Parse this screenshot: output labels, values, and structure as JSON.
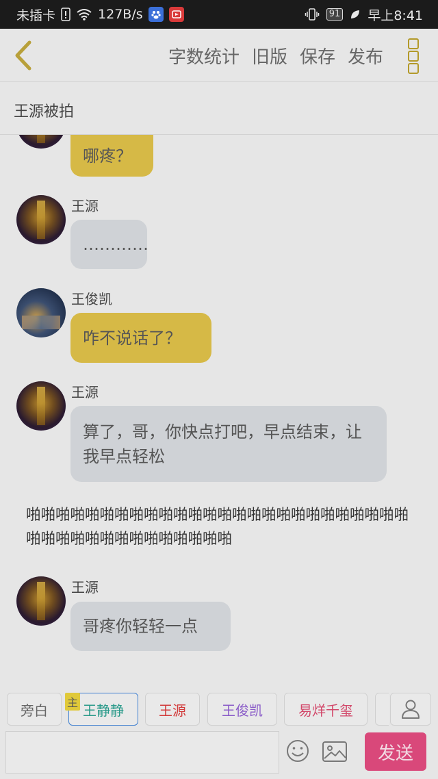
{
  "status_bar": {
    "carrier": "未插卡",
    "net_speed": "127B/s",
    "battery": "91",
    "time": "早上8:41"
  },
  "toolbar": {
    "actions": [
      "字数统计",
      "旧版",
      "保存",
      "发布"
    ]
  },
  "story": {
    "title": "王源被拍"
  },
  "messages": [
    {
      "sender": "",
      "text": "哪疼？",
      "style": "yellow",
      "avatar": "blue"
    },
    {
      "sender": "王源",
      "text": "…………",
      "style": "gray",
      "avatar": "gold"
    },
    {
      "sender": "王俊凯",
      "text": "咋不说话了？",
      "style": "yellow",
      "avatar": "blue"
    },
    {
      "sender": "王源",
      "text": "算了，哥，你快点打吧，早点结束，让我早点轻松",
      "style": "gray",
      "avatar": "gold"
    },
    {
      "sender": "王源",
      "text": "哥疼你轻轻一点",
      "style": "gray",
      "avatar": "gold"
    }
  ],
  "narration": "啪啪啪啪啪啪啪啪啪啪啪啪啪啪啪啪啪啪啪啪啪啪啪啪啪啪啪啪啪啪啪啪啪啪啪啪啪啪啪啪",
  "roles": {
    "main_badge": "主",
    "items": [
      {
        "label": "旁白",
        "color": "#666666"
      },
      {
        "label": "王静静",
        "color": "#2a9a8a"
      },
      {
        "label": "王源",
        "color": "#d23b3b"
      },
      {
        "label": "王俊凯",
        "color": "#8a5cc8"
      },
      {
        "label": "易烊千玺",
        "color": "#d2486a"
      }
    ]
  },
  "composer": {
    "input_value": "",
    "send_label": "发送"
  }
}
